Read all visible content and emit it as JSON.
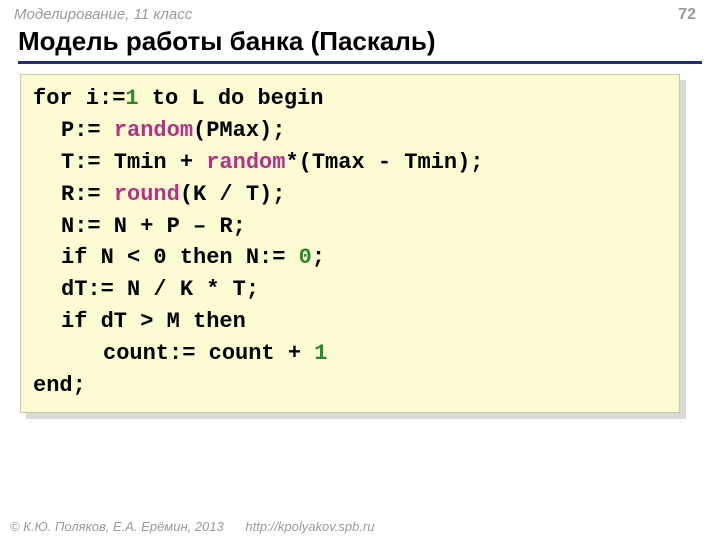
{
  "header": {
    "breadcrumb": "Моделирование, 11 класс",
    "page_number": "72",
    "title": "Модель работы банка (Паскаль)"
  },
  "code": {
    "lines": [
      {
        "indent": 0,
        "tokens": [
          {
            "t": "for i:=",
            "c": "kw"
          },
          {
            "t": "1",
            "c": "lit"
          },
          {
            "t": " to L do begin",
            "c": "kw"
          }
        ]
      },
      {
        "indent": 1,
        "tokens": [
          {
            "t": "P:=",
            "c": "kw"
          },
          {
            "t": " ",
            "c": "kw"
          },
          {
            "t": "random",
            "c": "fn"
          },
          {
            "t": "(PMax);",
            "c": "kw"
          }
        ]
      },
      {
        "indent": 1,
        "tokens": [
          {
            "t": "T:=",
            "c": "kw"
          },
          {
            "t": " Tmin",
            "c": "kw"
          },
          {
            "t": " + ",
            "c": "kw"
          },
          {
            "t": "random",
            "c": "fn"
          },
          {
            "t": "*(Tmax",
            "c": "kw"
          },
          {
            "t": " - ",
            "c": "kw"
          },
          {
            "t": "Tmin);",
            "c": "kw"
          }
        ]
      },
      {
        "indent": 1,
        "tokens": [
          {
            "t": "R:=",
            "c": "kw"
          },
          {
            "t": " ",
            "c": "kw"
          },
          {
            "t": "round",
            "c": "fn"
          },
          {
            "t": "(K",
            "c": "kw"
          },
          {
            "t": " / ",
            "c": "kw"
          },
          {
            "t": "T);",
            "c": "kw"
          }
        ]
      },
      {
        "indent": 1,
        "tokens": [
          {
            "t": "N:=",
            "c": "kw"
          },
          {
            "t": " N",
            "c": "kw"
          },
          {
            "t": " + ",
            "c": "kw"
          },
          {
            "t": "P",
            "c": "kw"
          },
          {
            "t": " – ",
            "c": "kw"
          },
          {
            "t": "R;",
            "c": "kw"
          }
        ]
      },
      {
        "indent": 1,
        "tokens": [
          {
            "t": "if N",
            "c": "kw"
          },
          {
            "t": " < ",
            "c": "kw"
          },
          {
            "t": "0 then N:=",
            "c": "kw"
          },
          {
            "t": " ",
            "c": "kw"
          },
          {
            "t": "0",
            "c": "lit"
          },
          {
            "t": ";",
            "c": "kw"
          }
        ]
      },
      {
        "indent": 1,
        "tokens": [
          {
            "t": "dT:=",
            "c": "kw"
          },
          {
            "t": " N",
            "c": "kw"
          },
          {
            "t": " / ",
            "c": "kw"
          },
          {
            "t": "K",
            "c": "kw"
          },
          {
            "t": " * ",
            "c": "kw"
          },
          {
            "t": "T;",
            "c": "kw"
          }
        ]
      },
      {
        "indent": 1,
        "tokens": [
          {
            "t": "if dT",
            "c": "kw"
          },
          {
            "t": " > ",
            "c": "kw"
          },
          {
            "t": "M then",
            "c": "kw"
          }
        ]
      },
      {
        "indent": 2,
        "tokens": [
          {
            "t": "count:= count + ",
            "c": "kw"
          },
          {
            "t": "1",
            "c": "lit"
          }
        ]
      },
      {
        "indent": 0,
        "tokens": [
          {
            "t": "end;",
            "c": "kw"
          }
        ]
      }
    ]
  },
  "footer": {
    "copyright": "© К.Ю. Поляков, Е.А. Ерёмин, 2013",
    "url": "http://kpolyakov.spb.ru"
  }
}
